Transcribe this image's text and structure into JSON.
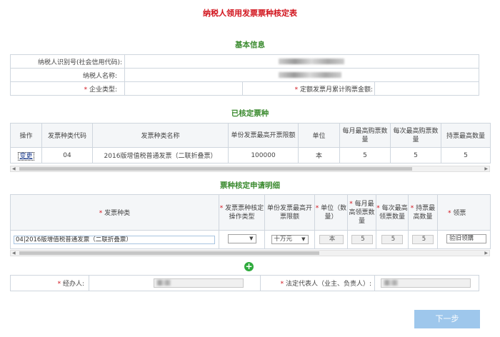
{
  "page_title": "纳税人领用发票票种核定表",
  "basic_info": {
    "title": "基本信息",
    "taxpayer_id_label": "纳税人识别号(社会信用代码):",
    "taxpayer_name_label": "纳税人名称:",
    "enterprise_type_label": "企业类型:",
    "monthly_amount_label": "定额发票月累计购票金额:",
    "required_mark": "*"
  },
  "approved_section": {
    "title": "已核定票种",
    "headers": [
      "操作",
      "发票种类代码",
      "发票种类名称",
      "单份发票最高开票限额",
      "单位",
      "每月最高购票数量",
      "每次最高购票数量",
      "持票最高数量"
    ],
    "rows": [
      {
        "action": "变更",
        "code": "04",
        "name": "2016版增值税普通发票（二联折叠票）",
        "limit": "100000",
        "unit": "本",
        "monthly": "5",
        "per_time": "5",
        "holding": "5"
      }
    ]
  },
  "apply_section": {
    "title": "票种核定申请明细",
    "headers": [
      "发票种类",
      "发票票种核定操作类型",
      "单份发票最高开票限额",
      "单位（数量）",
      "每月最高领票数量",
      "每次最高领票数量",
      "持票最高数量",
      "领票"
    ],
    "row": {
      "invoice_type": "04|2016版增值税普通发票（二联折叠票）",
      "op_type": "",
      "limit": "十万元",
      "unit": "本",
      "monthly": "5",
      "per_time": "5",
      "holding": "5",
      "receive": "验旧领購"
    }
  },
  "footer_fields": {
    "handler_label": "经办人:",
    "legal_rep_label": "法定代表人（业主、负责人）:",
    "required_mark": "*"
  },
  "icons": {
    "add": "plus-circle-icon",
    "dropdown": "dropdown-arrow-icon"
  },
  "next_button": "下一步",
  "colors": {
    "title_red": "#d1111a",
    "section_green": "#3a8a2e",
    "button_blue": "#9ec7ec",
    "add_green": "#2eaa3c"
  }
}
